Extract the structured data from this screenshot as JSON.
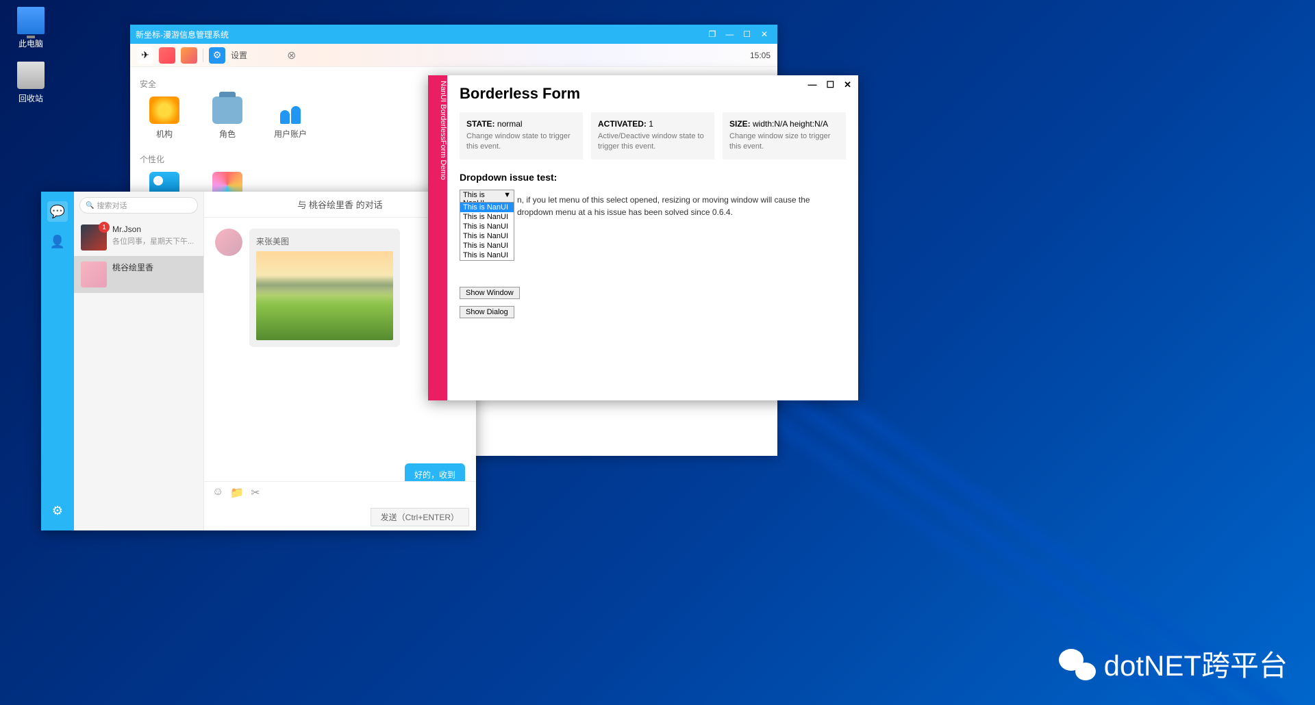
{
  "desktop": {
    "pc_label": "此电脑",
    "bin_label": "回收站"
  },
  "mgmt": {
    "title": "新坐标-漫游信息管理系统",
    "settings_label": "设置",
    "time": "15:05",
    "sec_security": "安全",
    "sec_personal": "个性化",
    "items": {
      "org": "机构",
      "role": "角色",
      "user": "用户账户"
    }
  },
  "chat": {
    "search_placeholder": "搜索对话",
    "header_title": "与 桃谷绘里香 的对话",
    "contacts": [
      {
        "name": "Mr.Json",
        "preview": "各位同事，星期天下午...",
        "badge": "1"
      },
      {
        "name": "桃谷绘里香",
        "preview": ""
      }
    ],
    "msg_in_text": "来张美图",
    "msg_out_text": "好的，收到",
    "send_label": "发送（Ctrl+ENTER）"
  },
  "bform": {
    "spine": "NanUI BorderlessForm Demo",
    "title": "Borderless Form",
    "cards": [
      {
        "k": "STATE:",
        "v": "normal",
        "d": "Change window state to trigger this event."
      },
      {
        "k": "ACTIVATED:",
        "v": "1",
        "d": "Active/Deactive window state to trigger this event."
      },
      {
        "k": "SIZE:",
        "v": "width:N/A height:N/A",
        "d": "Change window size to trigger this event."
      }
    ],
    "subtitle": "Dropdown issue test:",
    "dd_selected": "This is NanUI",
    "dd_options": [
      "This is NanUI",
      "This is NanUI",
      "This is NanUI",
      "This is NanUI",
      "This is NanUI",
      "This is NanUI"
    ],
    "desc_frag": "n, if you let menu of this select opened, resizing or moving window will cause the dropdown menu at a his issue has been solved since 0.6.4.",
    "btn_show_window": "Show Window",
    "btn_show_dialog": "Show Dialog"
  },
  "watermark": "dotNET跨平台"
}
